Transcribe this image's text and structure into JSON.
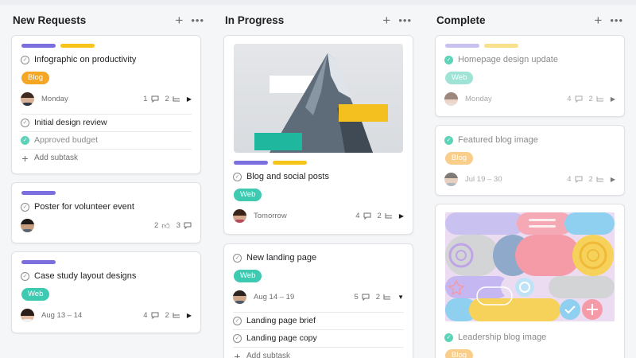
{
  "columns": [
    {
      "title": "New Requests",
      "cards": [
        {
          "title": "Infographic on productivity",
          "tag": "Blog",
          "date": "Monday",
          "comments": "1",
          "subtasks_count": "2",
          "subtasks": [
            {
              "label": "Initial design review",
              "done": false
            },
            {
              "label": "Approved budget",
              "done": true
            }
          ],
          "add_subtask": "Add subtask"
        },
        {
          "title": "Poster for volunteer event",
          "likes": "2",
          "comments": "3"
        },
        {
          "title": "Case study layout designs",
          "tag": "Web",
          "date": "Aug 13 – 14",
          "comments": "4",
          "subtasks_count": "2"
        }
      ]
    },
    {
      "title": "In Progress",
      "cards": [
        {
          "title": "Blog and social posts",
          "tag": "Web",
          "date": "Tomorrow",
          "comments": "4",
          "subtasks_count": "2"
        },
        {
          "title": "New landing page",
          "tag": "Web",
          "date": "Aug 14 – 19",
          "comments": "5",
          "subtasks_count": "2",
          "subtasks": [
            {
              "label": "Landing page brief",
              "done": false
            },
            {
              "label": "Landing page copy",
              "done": false
            }
          ],
          "add_subtask": "Add subtask"
        }
      ]
    },
    {
      "title": "Complete",
      "cards": [
        {
          "title": "Homepage design update",
          "tag": "Web",
          "date": "Monday",
          "comments": "4",
          "subtasks_count": "2"
        },
        {
          "title": "Featured blog image",
          "tag": "Blog",
          "date": "Jul 19 – 30",
          "comments": "4",
          "subtasks_count": "2"
        },
        {
          "title": "Leadership blog image",
          "tag": "Blog"
        }
      ]
    }
  ],
  "colors": {
    "purple": "#7b6fe0",
    "yellow": "#f7c41a",
    "blog": "#f5a623",
    "web": "#3dcab1",
    "done_check": "#5dd3b8"
  }
}
